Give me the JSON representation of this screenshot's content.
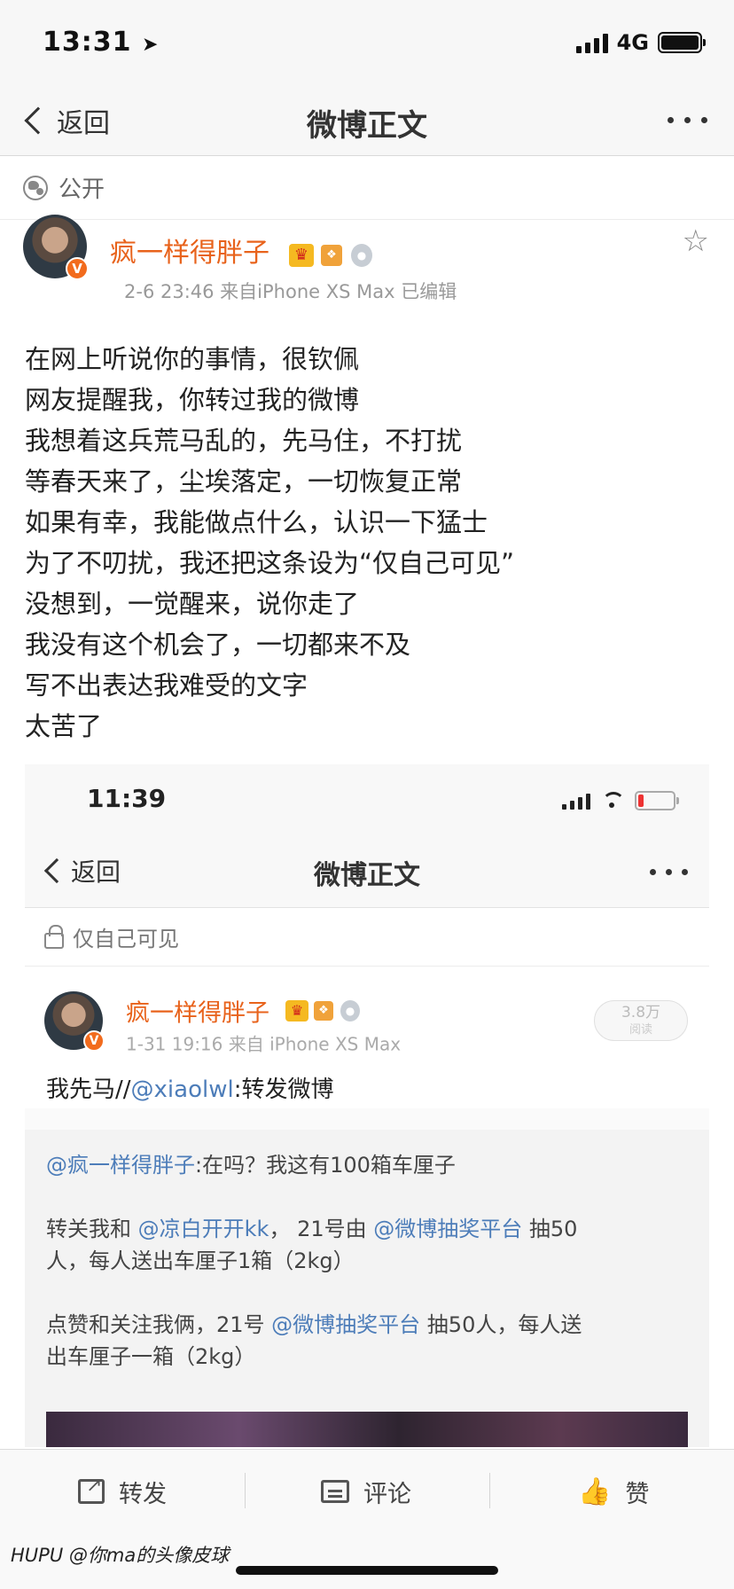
{
  "status_bar": {
    "time": "13:31",
    "network": "4G"
  },
  "nav": {
    "back_label": "返回",
    "title": "微博正文"
  },
  "visibility": {
    "label": "公开"
  },
  "post": {
    "username": "疯一样得胖子",
    "avatar_badge": "V",
    "meta": "2-6 23:46  来自iPhone XS Max  已编辑",
    "lines": [
      "在网上听说你的事情，很钦佩",
      "网友提醒我，你转过我的微博",
      "我想着这兵荒马乱的，先马住，不打扰",
      "等春天来了，尘埃落定，一切恢复正常",
      "如果有幸，我能做点什么，认识一下猛士",
      "为了不叨扰，我还把这条设为“仅自己可见”",
      "没想到，一觉醒来，说你走了",
      "我没有这个机会了，一切都来不及",
      "写不出表达我难受的文字",
      "太苦了"
    ]
  },
  "embedded": {
    "status_time": "11:39",
    "back_label": "返回",
    "title": "微博正文",
    "visibility": "仅自己可见",
    "username": "疯一样得胖子",
    "meta": "1-31 19:16  来自 iPhone XS Max",
    "read_count": "3.8万",
    "read_label": "阅读",
    "text_prefix": "我先马//",
    "text_mention": "@xiaolwl",
    "text_suffix": ":转发微博",
    "repost": {
      "line1_mention": "@疯一样得胖子",
      "line1_text": ":在吗？我这有100箱车厘子",
      "line2_a": "转关我和 ",
      "line2_mention1": "@凉白开开kk",
      "line2_b": "， 21号由 ",
      "line2_mention2": "@微博抽奖平台",
      "line2_c": " 抽50",
      "line3": "人，每人送出车厘子1箱（2kg）",
      "line4_a": "点赞和关注我俩，21号 ",
      "line4_mention": "@微博抽奖平台",
      "line4_b": " 抽50人，每人送",
      "line5": "出车厘子一箱（2kg）"
    }
  },
  "toolbar": {
    "repost_label": "转发",
    "comment_label": "评论",
    "like_label": "赞"
  },
  "watermark": "HUPU @你ma的头像皮球",
  "colors": {
    "username": "#e8631c",
    "link": "#4d7db9",
    "like": "#f26b1d"
  },
  "icons": [
    "location-arrow-icon",
    "signal-icon",
    "battery-icon",
    "chevron-left-icon",
    "more-icon",
    "globe-icon",
    "crown-badge-icon",
    "star-icon",
    "lock-icon",
    "wifi-icon",
    "share-icon",
    "comment-icon",
    "thumbs-up-icon"
  ]
}
